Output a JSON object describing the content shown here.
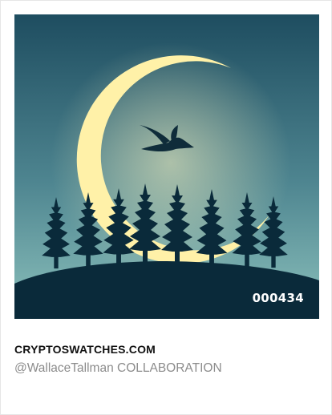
{
  "card": {
    "edition_number": "000434",
    "brand": "CRYPTOSWATCHES.COM",
    "credit": "@WallaceTallman COLLABORATION"
  },
  "artwork": {
    "subject": [
      "crescent-moon",
      "flying-bird",
      "pine-trees",
      "hill"
    ],
    "colors": {
      "sky_top": "#1e4d60",
      "sky_bottom": "#8cc1bc",
      "moon": "#fff1a8",
      "silhouette": "#0a2a3a"
    }
  }
}
